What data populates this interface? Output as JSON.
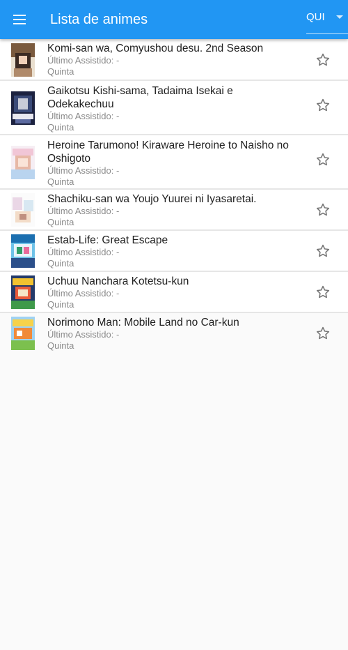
{
  "appbar": {
    "title": "Lista de animes",
    "menu_icon": "menu-icon",
    "day_select": {
      "selected": "QUI"
    },
    "color": "#2196f3"
  },
  "list": {
    "items": [
      {
        "title": "Komi-san wa, Comyushou desu. 2nd Season",
        "last_watched": "Último Assistido: -",
        "day": "Quinta",
        "starred": false
      },
      {
        "title": "Gaikotsu Kishi-sama, Tadaima Isekai e Odekakechuu",
        "last_watched": "Último Assistido: -",
        "day": "Quinta",
        "starred": false
      },
      {
        "title": "Heroine Tarumono! Kiraware Heroine to Naisho no Oshigoto",
        "last_watched": "Último Assistido: -",
        "day": "Quinta",
        "starred": false
      },
      {
        "title": "Shachiku-san wa Youjo Yuurei ni Iyasaretai.",
        "last_watched": "Último Assistido: -",
        "day": "Quinta",
        "starred": false
      },
      {
        "title": "Estab-Life: Great Escape",
        "last_watched": "Último Assistido: -",
        "day": "Quinta",
        "starred": false
      },
      {
        "title": "Uchuu Nanchara Kotetsu-kun",
        "last_watched": "Último Assistido: -",
        "day": "Quinta",
        "starred": false
      },
      {
        "title": "Norimono Man: Mobile Land no Car-kun",
        "last_watched": "Último Assistido: -",
        "day": "Quinta",
        "starred": false
      }
    ]
  }
}
